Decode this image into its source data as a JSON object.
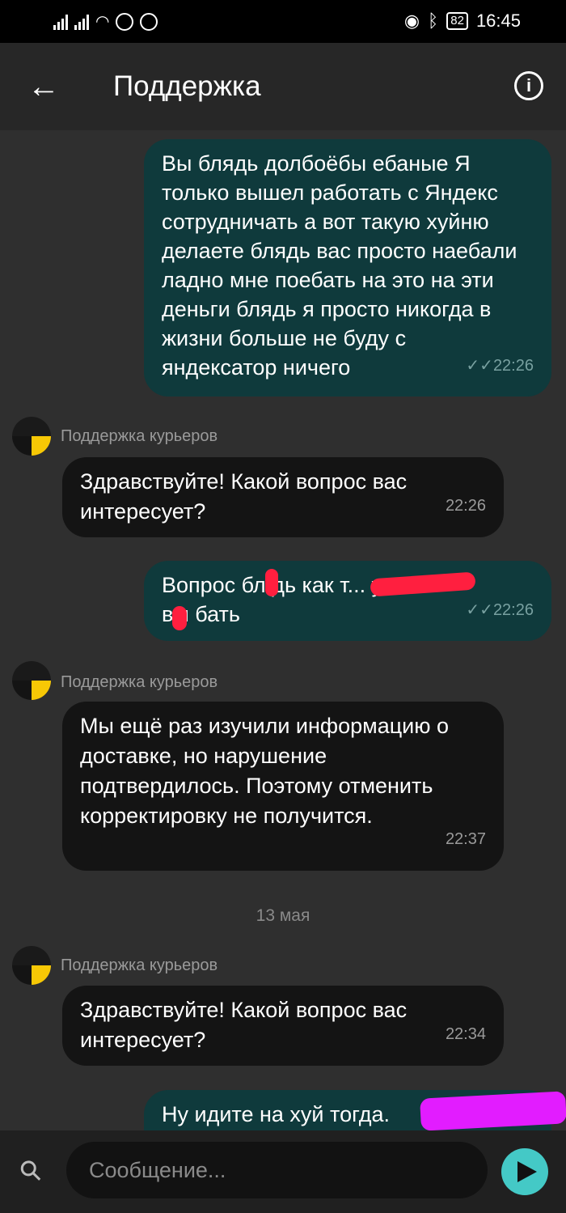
{
  "status_bar": {
    "battery": "82",
    "time": "16:45"
  },
  "header": {
    "title": "Поддержка"
  },
  "messages": [
    {
      "type": "out",
      "text": "Вы блядь долбоёбы ебаные Я только вышел работать с Яндекс сотрудничать а вот такую хуйню делаете блядь вас просто наебали ладно мне поебать на это на эти деньги блядь я просто никогда в жизни больше не буду с яндексатор ничего",
      "time": "22:26"
    },
    {
      "type": "in",
      "sender": "Поддержка курьеров",
      "text": "Здравствуйте! Какой вопрос вас интересует?",
      "time": "22:26"
    },
    {
      "type": "out",
      "text": "Вопрос бл дь как т... у\nвы бать",
      "time": "22:26"
    },
    {
      "type": "in",
      "sender": "Поддержка курьеров",
      "text": "Мы ещё раз изучили информацию о доставке, но нарушение подтвердилось. Поэтому отменить корректировку не получится.",
      "time": "22:37"
    },
    {
      "type": "date",
      "text": "13 мая"
    },
    {
      "type": "in",
      "sender": "Поддержка курьеров",
      "text": "Здравствуйте! Какой вопрос вас интересует?",
      "time": "22:34"
    },
    {
      "type": "out",
      "text": "Ну идите на хуй тогда."
    }
  ],
  "composer": {
    "placeholder": "Сообщение..."
  },
  "colors": {
    "outgoing_bubble": "#0f3a3c",
    "incoming_bubble": "#141414",
    "send_button": "#44c9c6",
    "redaction_red": "#ff1f3f",
    "redaction_magenta": "#e21cff"
  }
}
